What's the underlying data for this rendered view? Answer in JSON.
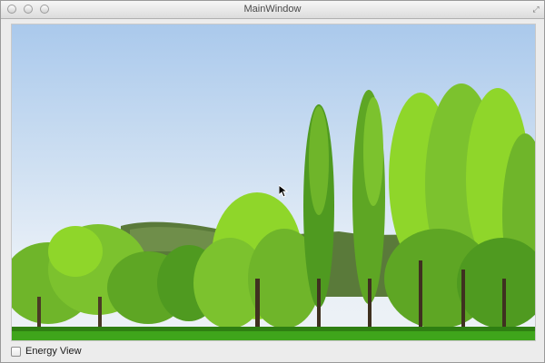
{
  "window": {
    "title": "MainWindow"
  },
  "viewport": {
    "content": "landscape-photo"
  },
  "controls": {
    "energy_view": {
      "label": "Energy View",
      "checked": false
    }
  },
  "colors": {
    "sky_top": "#aac9ec",
    "grass": "#3fa51b",
    "foliage_light": "#8fd62a",
    "foliage_dark": "#3e8a16"
  }
}
